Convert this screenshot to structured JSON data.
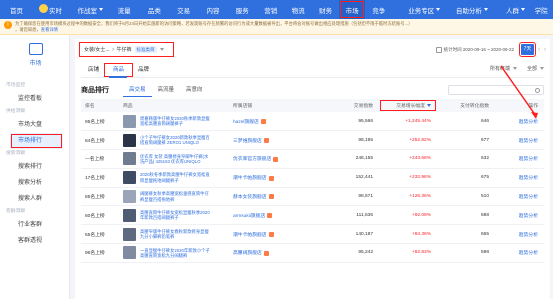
{
  "topnav": {
    "items": [
      {
        "label": "首页",
        "dd": false
      },
      {
        "label": "实时",
        "dd": false
      },
      {
        "label": "作战室",
        "dd": true
      },
      {
        "label": "流量",
        "dd": false
      },
      {
        "label": "品类",
        "dd": false
      },
      {
        "label": "交易",
        "dd": false
      },
      {
        "label": "内容",
        "dd": false
      },
      {
        "label": "服务",
        "dd": false
      },
      {
        "label": "营销",
        "dd": false
      },
      {
        "label": "物流",
        "dd": false
      },
      {
        "label": "财务",
        "dd": false
      },
      {
        "label": "市场",
        "dd": false
      },
      {
        "label": "竞争",
        "dd": false
      },
      {
        "label": "业务专区",
        "dd": true
      },
      {
        "label": "自助分析",
        "dd": true
      },
      {
        "label": "人群",
        "dd": true
      },
      {
        "label": "学院",
        "dd": false
      }
    ],
    "active_index": 11
  },
  "notice": {
    "line1": "为了确保您在使用市场模块过程中的数据安全，我们将于6月24日开始实施新的访问策略，若发现账号存在频繁的访问行为或大量数据被导出，平台将会对账号做出相应处理措施（包括但不限于临时冻结账号...）",
    "line2": "，请您知悉，",
    "link": "查看详情"
  },
  "sidebar": {
    "title": "市场",
    "sections": [
      {
        "label": "市场监控",
        "items": [
          "监控看板"
        ]
      },
      {
        "label": "供给洞察",
        "items": [
          "市场大盘",
          "市场排行"
        ]
      },
      {
        "label": "搜索洞察",
        "items": [
          "搜索排行",
          "搜索分析",
          "搜索人群"
        ]
      },
      {
        "label": "客群洞察",
        "items": [
          "行业客群",
          "客群透视"
        ]
      }
    ],
    "active": "市场排行"
  },
  "main": {
    "category": "女装/女士...",
    "chevron": ">",
    "subcategory": "牛仔裤",
    "pill": "标准类目",
    "stat_time": "统计时间 2020-09-16 ~ 2020-09-22",
    "period_active": "7天",
    "tabs": [
      "店铺",
      "商品",
      "品牌"
    ],
    "tab_active": "商品",
    "filters": [
      "所有终端",
      "全部"
    ],
    "rank_title": "商品排行",
    "rank_tabs": [
      "高交易",
      "高流量",
      "高意向"
    ],
    "rank_tab_active": "高交易",
    "columns": [
      "排名",
      "商品",
      "所属店铺",
      "交易指数",
      "交易增长幅度",
      "支付转化指数",
      "操作"
    ],
    "op_label": "趋势分析",
    "rows": [
      {
        "rank": "95名上榜",
        "name": "周嘉韩版牛仔裤女2020秋季新款显瘦宽松高腰直筒阔腿裤子",
        "shop": "hazel旗舰店",
        "trade": "95,566",
        "growth": "+1,245.44%",
        "conv": "646",
        "thumb": "#8a99ad"
      },
      {
        "rank": "84名上榜",
        "name": "小个子牛仔裤女2020新款秋季显瘦百搭直筒阔腿裤 ZERO1 UNIQLO",
        "shop": "三梦维旗舰店",
        "trade": "98,195",
        "growth": "+252.82%",
        "conv": "677",
        "thumb": "#2b3547"
      },
      {
        "rank": "—名上榜",
        "name": "优衣库 女装 高腰修身窄脚牛仔裤(水洗产品) 425163 优衣库UNIQLO",
        "shop": "优衣库官方旗舰店",
        "trade": "248,155",
        "growth": "+243.68%",
        "conv": "632",
        "thumb": "#6f7c8f"
      },
      {
        "rank": "17名上榜",
        "name": "2020秋冬季新款高腰牛仔裤女宽松直筒显瘦拖地阔腿裤子",
        "shop": "潮牛卡帕旗舰店",
        "trade": "152,441",
        "growth": "+232.98%",
        "conv": "675",
        "thumb": "#3e4b63"
      },
      {
        "rank": "85名上榜",
        "name": "阔腿裤女秋季高腰宽松垂感直筒牛仔裤显瘦百搭拖地裤",
        "shop": "赫本女装旗舰店",
        "trade": "98,671",
        "growth": "+126.36%",
        "conv": "510",
        "thumb": "#9aa6b8"
      },
      {
        "rank": "60名上榜",
        "name": "高腰直筒牛仔裤女宽松显瘦秋季2020年新款百搭阔腿裤子",
        "shop": "armsukii旗舰店",
        "trade": "111,636",
        "growth": "+92.09%",
        "conv": "688",
        "thumb": "#4f5d74"
      },
      {
        "rank": "55名上榜",
        "name": "高腰窄版牛仔裤女春秋新款修身显瘦九分小脚裤铅笔裤",
        "shop": "潮牛卡帕旗舰店",
        "trade": "140,187",
        "growth": "+84.38%",
        "conv": "665",
        "thumb": "#5d6a80"
      },
      {
        "rank": "96名上榜",
        "name": "一直显瘦牛仔裤女2020年新款小个子高腰直筒宽松九分阔腿裤",
        "shop": "高腰阔旗舰店",
        "trade": "95,242",
        "growth": "+82.83%",
        "conv": "598",
        "thumb": "#7e8ba0"
      }
    ]
  },
  "colors": {
    "brand": "#2f6fde",
    "highlight": "#ff1f1f",
    "growth": "#f5222d"
  }
}
